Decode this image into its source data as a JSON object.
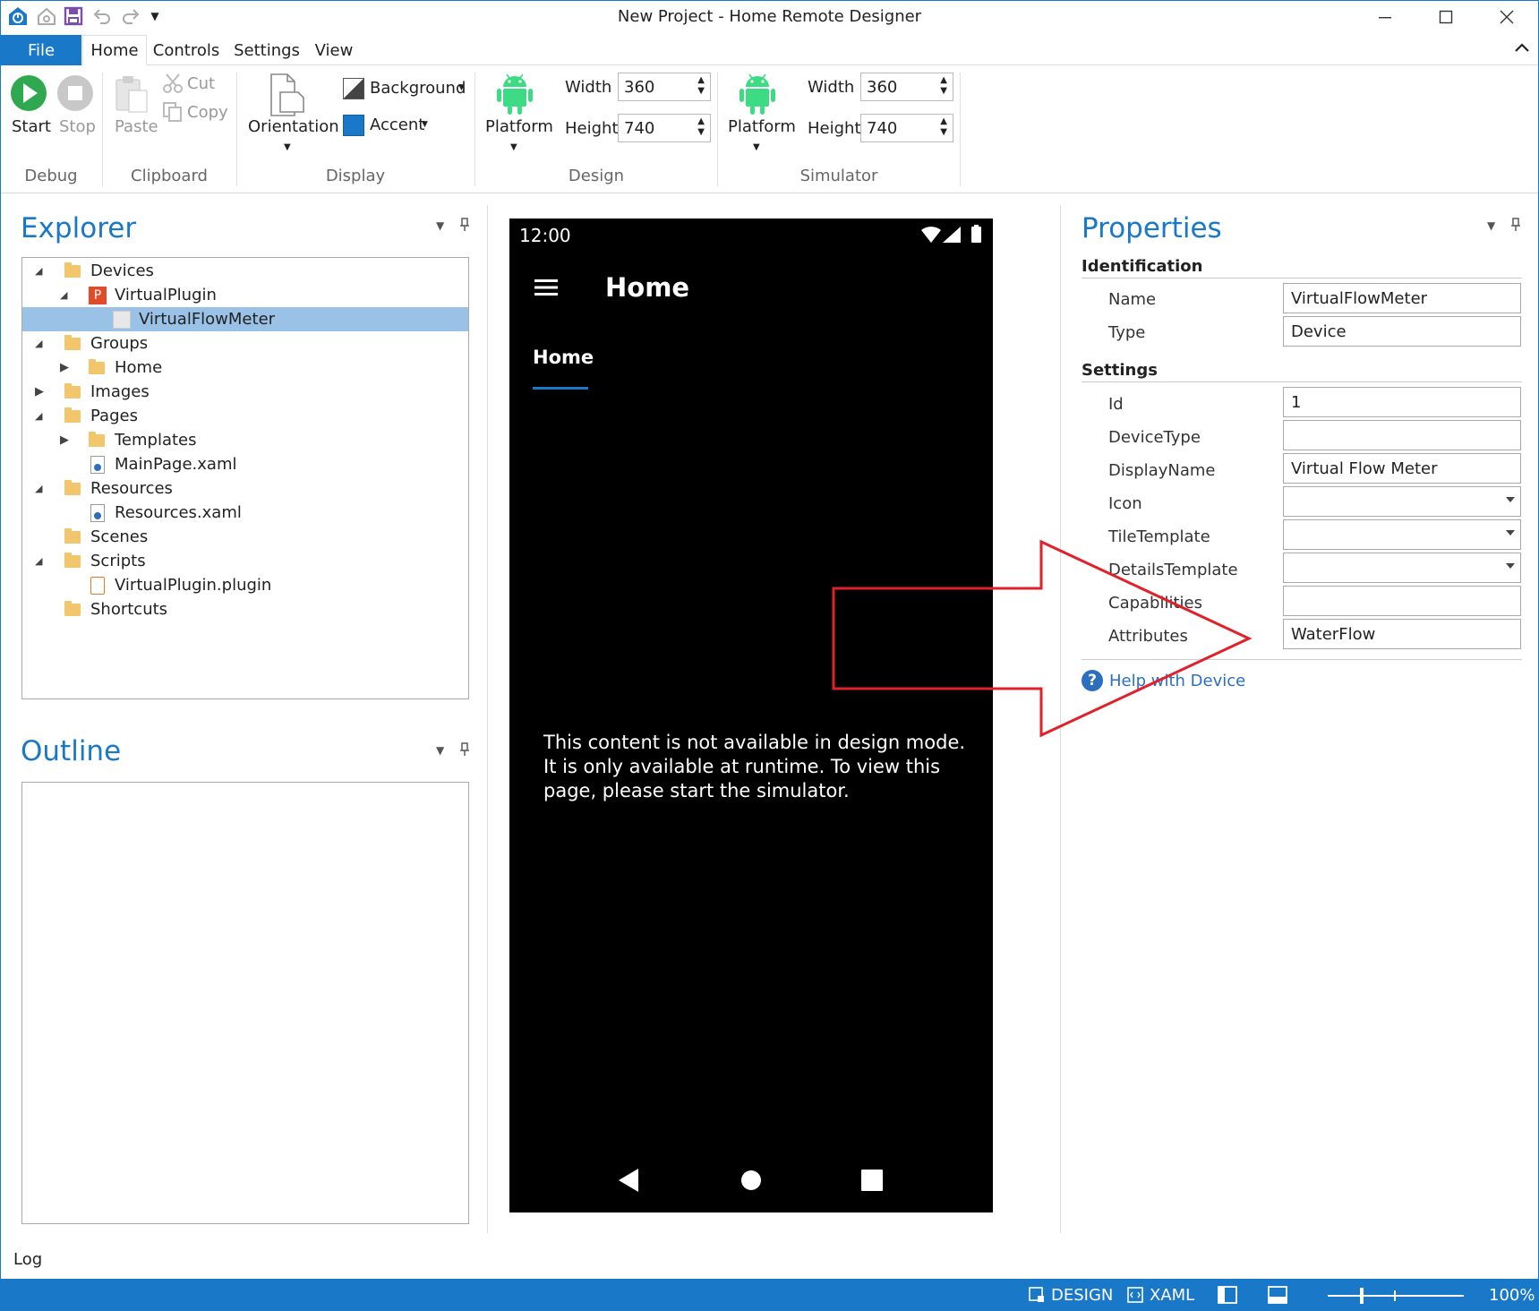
{
  "window": {
    "title": "New Project - Home Remote Designer"
  },
  "menu": {
    "file": "File",
    "tabs": [
      "Home",
      "Controls",
      "Settings",
      "View"
    ]
  },
  "ribbon": {
    "debug": {
      "label": "Debug",
      "start": "Start",
      "stop": "Stop"
    },
    "clipboard": {
      "label": "Clipboard",
      "paste": "Paste",
      "cut": "Cut",
      "copy": "Copy"
    },
    "display": {
      "label": "Display",
      "orientation": "Orientation",
      "background": "Background",
      "accent": "Accent"
    },
    "design": {
      "label": "Design",
      "platform": "Platform",
      "width_label": "Width",
      "width_value": "360",
      "height_label": "Height",
      "height_value": "740"
    },
    "simulator": {
      "label": "Simulator",
      "platform": "Platform",
      "width_label": "Width",
      "width_value": "360",
      "height_label": "Height",
      "height_value": "740"
    }
  },
  "explorer": {
    "title": "Explorer",
    "items": [
      {
        "label": "Devices"
      },
      {
        "label": "VirtualPlugin"
      },
      {
        "label": "VirtualFlowMeter"
      },
      {
        "label": "Groups"
      },
      {
        "label": "Home"
      },
      {
        "label": "Images"
      },
      {
        "label": "Pages"
      },
      {
        "label": "Templates"
      },
      {
        "label": "MainPage.xaml"
      },
      {
        "label": "Resources"
      },
      {
        "label": "Resources.xaml"
      },
      {
        "label": "Scenes"
      },
      {
        "label": "Scripts"
      },
      {
        "label": "VirtualPlugin.plugin"
      },
      {
        "label": "Shortcuts"
      }
    ]
  },
  "outline": {
    "title": "Outline"
  },
  "phone": {
    "time": "12:00",
    "app_title": "Home",
    "tab": "Home",
    "message": "This content is not available in design mode. It is only available at runtime. To view this page, please start the simulator."
  },
  "properties": {
    "title": "Properties",
    "identification": "Identification",
    "name_label": "Name",
    "name_value": "VirtualFlowMeter",
    "type_label": "Type",
    "type_value": "Device",
    "settings": "Settings",
    "id_label": "Id",
    "id_value": "1",
    "devicetype_label": "DeviceType",
    "devicetype_value": "",
    "displayname_label": "DisplayName",
    "displayname_value": "Virtual Flow Meter",
    "icon_label": "Icon",
    "tiletemplate_label": "TileTemplate",
    "detailstemplate_label": "DetailsTemplate",
    "capabilities_label": "Capabilities",
    "attributes_label": "Attributes",
    "attributes_value": "WaterFlow",
    "help": "Help with Device"
  },
  "log": {
    "label": "Log"
  },
  "status": {
    "design": "DESIGN",
    "xaml": "XAML",
    "zoom": "100%",
    "zoom_level": 0.24
  },
  "colors": {
    "accent": "#1a78c8",
    "android_green": "#3ddc84",
    "annotation_red": "#e0202a"
  }
}
